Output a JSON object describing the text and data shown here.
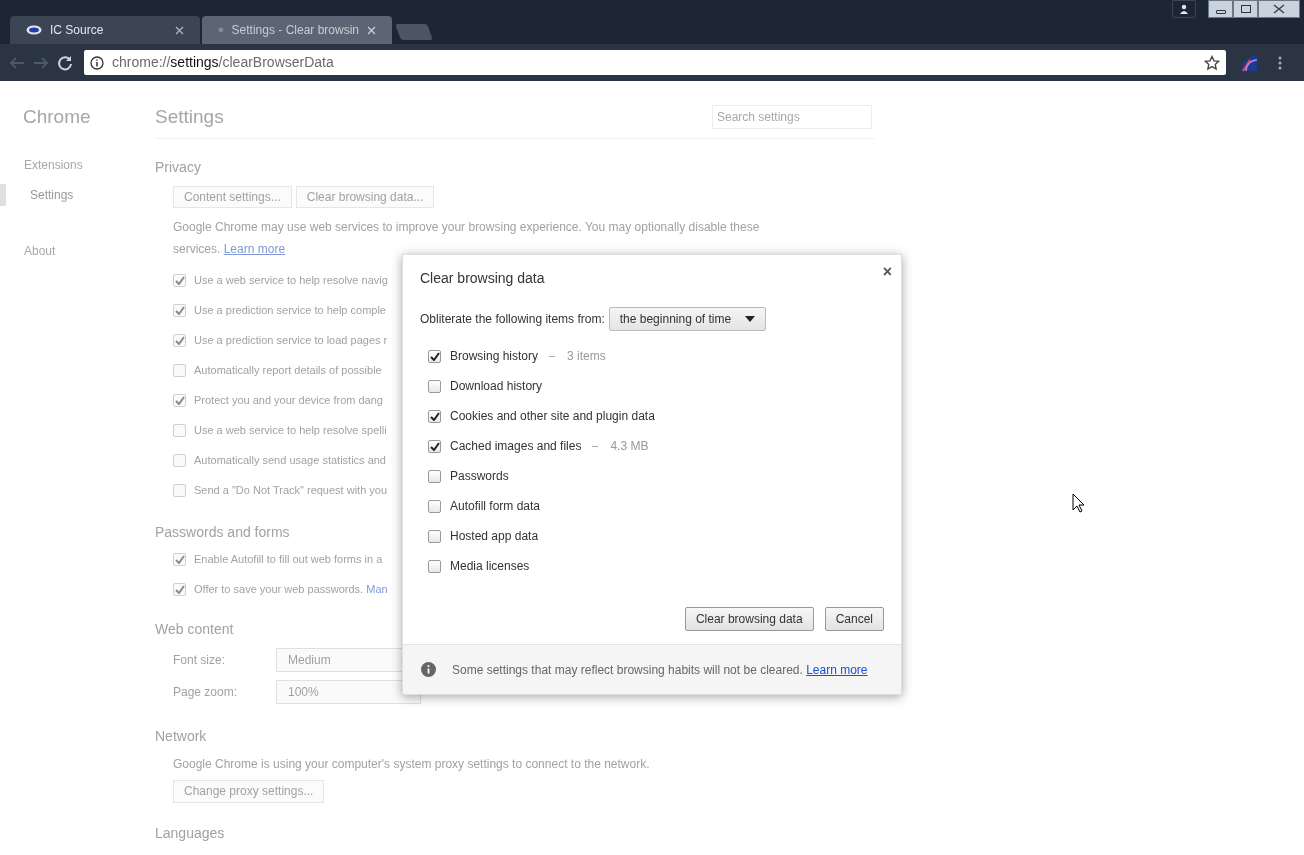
{
  "tabs": [
    {
      "label": "IC Source",
      "selected": false
    },
    {
      "label": "Settings - Clear browsin",
      "selected": true
    }
  ],
  "address_bar": {
    "scheme": "chrome://",
    "host": "settings",
    "path": "/clearBrowserData"
  },
  "sidebar": {
    "title": "Chrome",
    "items": [
      {
        "label": "Extensions",
        "selected": false
      },
      {
        "label": "Settings",
        "selected": true
      },
      {
        "label": "About",
        "selected": false
      }
    ]
  },
  "settings": {
    "title": "Settings",
    "search_placeholder": "Search settings",
    "privacy": {
      "heading": "Privacy",
      "buttons": [
        "Content settings...",
        "Clear browsing data..."
      ],
      "description": "Google Chrome may use web services to improve your browsing experience. You may optionally disable these services.",
      "link": "Learn more",
      "options": [
        {
          "label": "Use a web service to help resolve navig",
          "checked": true
        },
        {
          "label": "Use a prediction service to help comple",
          "checked": true
        },
        {
          "label": "Use a prediction service to load pages r",
          "checked": true
        },
        {
          "label": "Automatically report details of possible",
          "checked": false
        },
        {
          "label": "Protect you and your device from dang",
          "checked": true
        },
        {
          "label": "Use a web service to help resolve spelli",
          "checked": false
        },
        {
          "label": "Automatically send usage statistics and",
          "checked": false
        },
        {
          "label": "Send a \"Do Not Track\" request with you",
          "checked": false
        }
      ]
    },
    "passwords": {
      "heading": "Passwords and forms",
      "options": [
        {
          "label": "Enable Autofill to fill out web forms in a",
          "checked": true
        },
        {
          "label": "Offer to save your web passwords.",
          "link": "Man",
          "checked": true
        }
      ]
    },
    "web_content": {
      "heading": "Web content",
      "fields": [
        {
          "label": "Font size:",
          "value": "Medium"
        },
        {
          "label": "Page zoom:",
          "value": "100%"
        }
      ]
    },
    "network": {
      "heading": "Network",
      "description": "Google Chrome is using your computer's system proxy settings to connect to the network.",
      "button": "Change proxy settings..."
    },
    "languages": {
      "heading": "Languages"
    }
  },
  "dialog": {
    "title": "Clear browsing data",
    "close": "×",
    "period_label": "Obliterate the following items from:",
    "period": "the beginning of time",
    "items": [
      {
        "label": "Browsing history",
        "detail": "3 items",
        "checked": true
      },
      {
        "label": "Download history",
        "checked": false
      },
      {
        "label": "Cookies and other site and plugin data",
        "checked": true
      },
      {
        "label": "Cached images and files",
        "detail": "4.3 MB",
        "checked": true
      },
      {
        "label": "Passwords",
        "checked": false
      },
      {
        "label": "Autofill form data",
        "checked": false
      },
      {
        "label": "Hosted app data",
        "checked": false
      },
      {
        "label": "Media licenses",
        "checked": false
      }
    ],
    "buttons": [
      "Clear browsing data",
      "Cancel"
    ],
    "footer": "Some settings that may reflect browsing habits will not be cleared.",
    "footer_link": "Learn more"
  }
}
